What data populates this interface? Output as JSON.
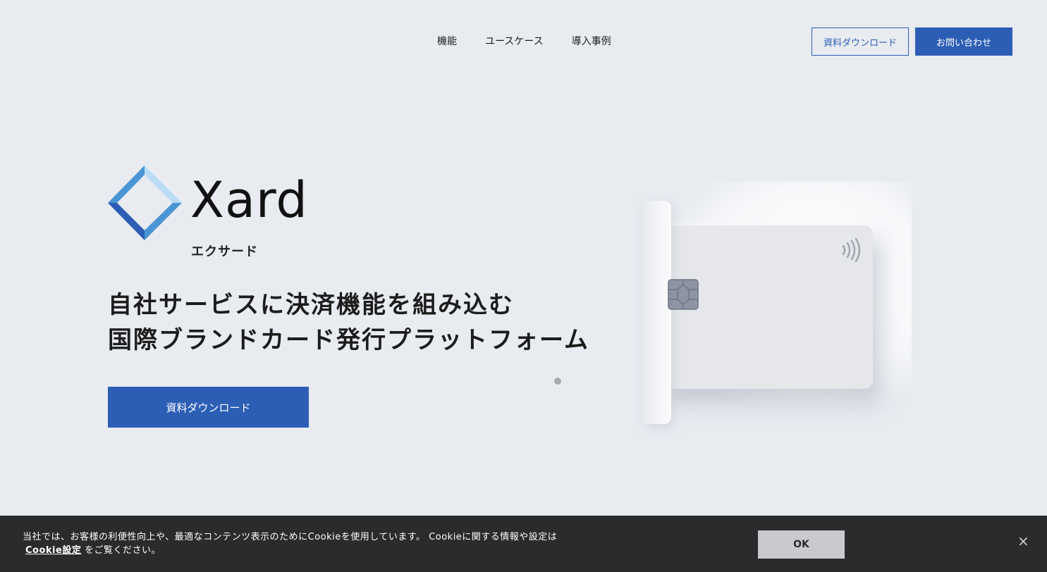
{
  "header": {
    "nav": [
      "機能",
      "ユースケース",
      "導入事例"
    ],
    "download_label": "資料ダウンロード",
    "contact_label": "お問い合わせ"
  },
  "logo": {
    "word": "Xard",
    "kana": "エクサード"
  },
  "hero": {
    "title_line1": "自社サービスに決済機能を組み込む",
    "title_line2": "国際ブランドカード発行プラットフォーム",
    "cta_label": "資料ダウンロード"
  },
  "cookie": {
    "text_line1": "当社では、お客様の利便性向上や、最適なコンテンツ表示のためにCookieを使用しています。 Cookieに関する情報や設定は",
    "link_label": "Cookie設定",
    "text_line2": "をご覧ください。",
    "ok_label": "OK",
    "close_symbol": "×"
  },
  "colors": {
    "brand_blue": "#2d5eb6",
    "background": "#e8ebf0",
    "cookie_bar": "#2a2b2d"
  },
  "icons": [
    "xard-diamond-logo-icon",
    "card-chip-icon",
    "contactless-icon",
    "close-icon"
  ]
}
